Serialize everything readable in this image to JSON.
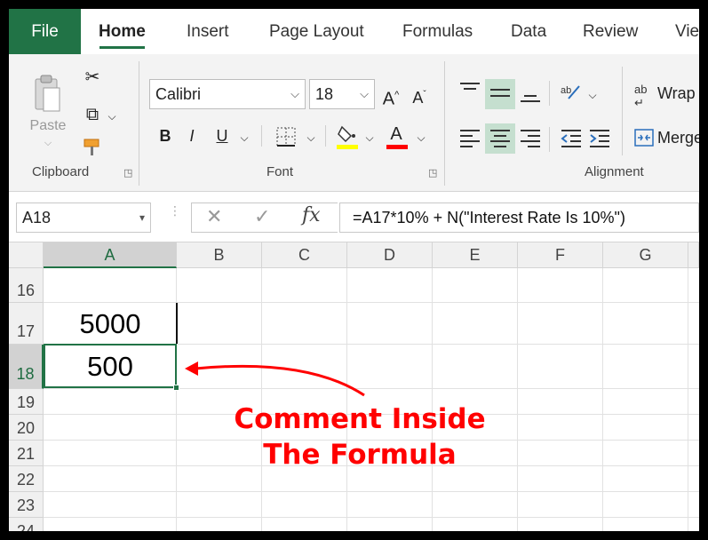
{
  "tabs": [
    {
      "label": "File"
    },
    {
      "label": "Home"
    },
    {
      "label": "Insert"
    },
    {
      "label": "Page Layout"
    },
    {
      "label": "Formulas"
    },
    {
      "label": "Data"
    },
    {
      "label": "Review"
    },
    {
      "label": "Vie"
    }
  ],
  "clipboard": {
    "group_label": "Clipboard",
    "paste_label": "Paste"
  },
  "font": {
    "group_label": "Font",
    "font_name": "Calibri",
    "font_size": "18",
    "bold": "B",
    "italic": "I",
    "underline": "U",
    "grow": "A",
    "shrink": "A",
    "font_color_letter": "A",
    "fill_color": "#ffff00",
    "text_color": "#ff0000"
  },
  "alignment": {
    "group_label": "Alignment",
    "wrap_label": "Wrap",
    "merge_label": "Merge"
  },
  "formula_bar": {
    "name_box": "A18",
    "formula": "=A17*10% + N(\"Interest Rate Is 10%\")"
  },
  "grid": {
    "columns": [
      "A",
      "B",
      "C",
      "D",
      "E",
      "F",
      "G"
    ],
    "rows": [
      "16",
      "17",
      "18",
      "19",
      "20",
      "21",
      "22",
      "23",
      "24"
    ],
    "cells": {
      "A17": "5000",
      "A18": "500"
    },
    "selected_cell": "A18"
  },
  "annotation": {
    "line1": "Comment Inside",
    "line2": "The Formula",
    "color": "#ff0000"
  },
  "theme": {
    "accent": "#217346"
  }
}
